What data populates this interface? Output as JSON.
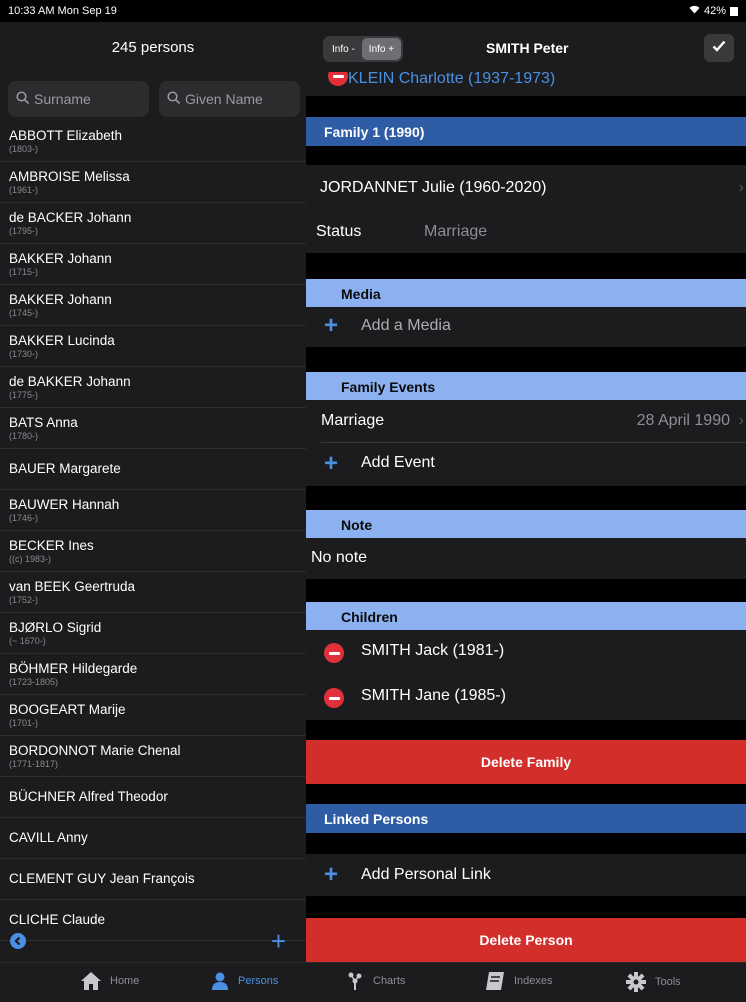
{
  "status": {
    "time": "10:33 AM  Mon Sep 19",
    "battery": "42%"
  },
  "left": {
    "title": "245 persons",
    "search_surname_placeholder": "Surname",
    "search_given_placeholder": "Given Name",
    "persons": [
      {
        "name": "ABBOTT Elizabeth",
        "dates": "(1803-)"
      },
      {
        "name": "AMBROISE Melissa",
        "dates": "(1961-)"
      },
      {
        "name": "de BACKER Johann",
        "dates": "(1795-)"
      },
      {
        "name": "BAKKER Johann",
        "dates": "(1715-)"
      },
      {
        "name": "BAKKER Johann",
        "dates": "(1745-)"
      },
      {
        "name": "BAKKER Lucinda",
        "dates": "(1730-)"
      },
      {
        "name": "de BAKKER Johann",
        "dates": "(1775-)"
      },
      {
        "name": "BATS Anna",
        "dates": "(1780-)"
      },
      {
        "name": "BAUER Margarete",
        "dates": ""
      },
      {
        "name": "BAUWER Hannah",
        "dates": "(1746-)"
      },
      {
        "name": "BECKER Ines",
        "dates": "((c) 1983-)"
      },
      {
        "name": "van BEEK Geertruda",
        "dates": "(1752-)"
      },
      {
        "name": "BJØRLO Sigrid",
        "dates": "(~ 1670-)"
      },
      {
        "name": "BÖHMER Hildegarde",
        "dates": "(1723-1805)"
      },
      {
        "name": "BOOGEART Marije",
        "dates": "(1701-)"
      },
      {
        "name": "BORDONNOT Marie Chenal",
        "dates": "(1771-1817)"
      },
      {
        "name": "BÜCHNER Alfred Theodor",
        "dates": ""
      },
      {
        "name": "CAVILL Anny",
        "dates": ""
      },
      {
        "name": "CLEMENT GUY Jean François",
        "dates": ""
      },
      {
        "name": "CLICHE Claude",
        "dates": ""
      }
    ]
  },
  "right": {
    "seg_minus": "Info -",
    "seg_plus": "Info +",
    "title": "SMITH Peter",
    "cut_person": "KLEIN Charlotte (1937-1973)",
    "family_header": "Family 1 (1990)",
    "spouse": "JORDANNET Julie (1960-2020)",
    "status_label": "Status",
    "status_value": "Marriage",
    "media_header": "Media",
    "add_media": "Add a Media",
    "events_header": "Family Events",
    "event_name": "Marriage",
    "event_date": "28 April 1990",
    "add_event": "Add Event",
    "note_header": "Note",
    "note_text": "No note",
    "children_header": "Children",
    "children": [
      "SMITH Jack (1981-)",
      "SMITH Jane  (1985-)"
    ],
    "delete_family": "Delete Family",
    "linked_header": "Linked Persons",
    "add_link": "Add Personal Link",
    "delete_person": "Delete Person"
  },
  "tabs": [
    {
      "label": "Home",
      "icon": "home-icon"
    },
    {
      "label": "Persons",
      "icon": "person-icon"
    },
    {
      "label": "Charts",
      "icon": "tree-icon"
    },
    {
      "label": "Indexes",
      "icon": "book-icon"
    },
    {
      "label": "Tools",
      "icon": "gear-icon"
    }
  ],
  "colors": {
    "accent": "#4a90e2",
    "section_dark": "#2e5da6",
    "section_light": "#8cb1f0",
    "delete_red": "#d32f2a"
  }
}
